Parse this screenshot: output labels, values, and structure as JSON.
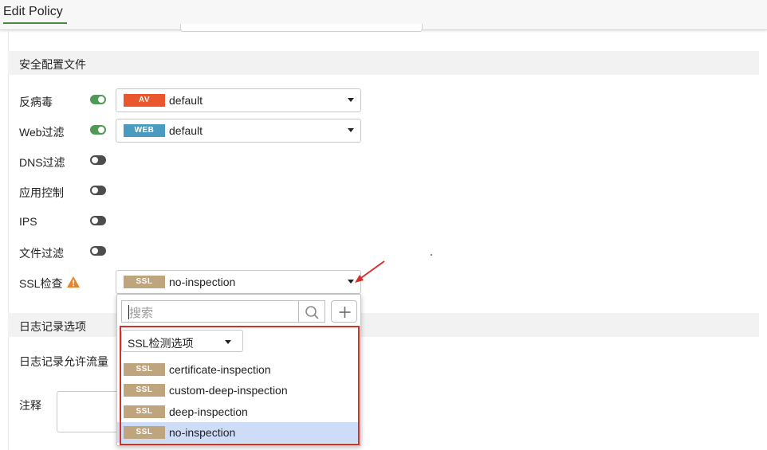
{
  "header": {
    "title": "Edit Policy"
  },
  "security_profiles": {
    "section_title": "安全配置文件",
    "rows": [
      {
        "label": "反病毒",
        "enabled": true,
        "badge": "AV",
        "value": "default"
      },
      {
        "label": "Web过滤",
        "enabled": true,
        "badge": "WEB",
        "value": "default"
      },
      {
        "label": "DNS过滤",
        "enabled": false
      },
      {
        "label": "应用控制",
        "enabled": false
      },
      {
        "label": "IPS",
        "enabled": false
      },
      {
        "label": "文件过滤",
        "enabled": false
      }
    ],
    "ssl": {
      "label": "SSL检查",
      "badge": "SSL",
      "value": "no-inspection"
    }
  },
  "dropdown": {
    "search_placeholder": "搜索",
    "filter_label": "SSL检测选项",
    "options": [
      {
        "badge": "SSL",
        "label": "certificate-inspection",
        "selected": false
      },
      {
        "badge": "SSL",
        "label": "custom-deep-inspection",
        "selected": false
      },
      {
        "badge": "SSL",
        "label": "deep-inspection",
        "selected": false
      },
      {
        "badge": "SSL",
        "label": "no-inspection",
        "selected": true
      }
    ]
  },
  "logging": {
    "section_title": "日志记录选项",
    "allowed_traffic_label": "日志记录允许流量"
  },
  "comments": {
    "label": "注释"
  },
  "colors": {
    "accent_green": "#4f9a56",
    "av_badge": "#e8572e",
    "web_badge": "#4a9bbf",
    "ssl_badge": "#bfa57e",
    "highlight_red": "#d4302a",
    "warning_orange": "#e8832a"
  },
  "icons": [
    "warning-icon",
    "search-icon",
    "plus-icon",
    "dropdown-caret-icon",
    "annotation-arrow"
  ]
}
